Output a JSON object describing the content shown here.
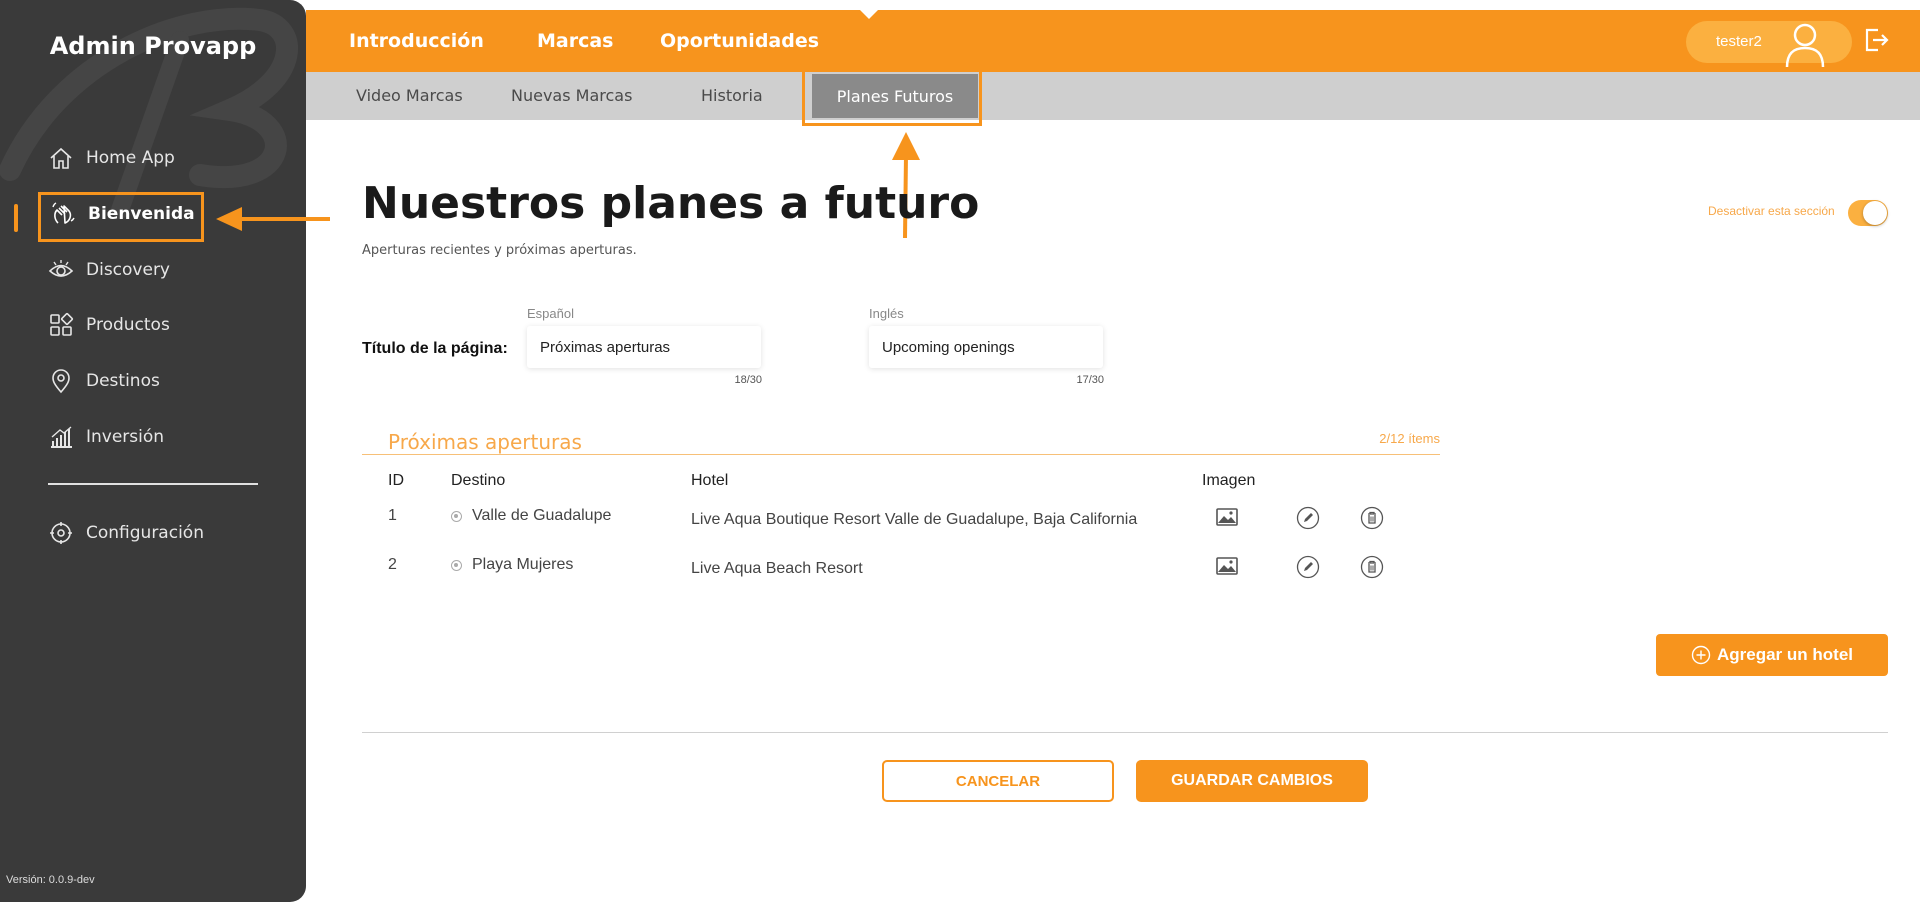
{
  "sidebar": {
    "title": "Admin Provapp",
    "items": [
      {
        "label": "Home App",
        "icon": "home-icon"
      },
      {
        "label": "Bienvenida",
        "icon": "waving-hand-icon",
        "active": true
      },
      {
        "label": "Discovery",
        "icon": "eye-icon"
      },
      {
        "label": "Productos",
        "icon": "grid-icon"
      },
      {
        "label": "Destinos",
        "icon": "location-pin-icon"
      },
      {
        "label": "Inversión",
        "icon": "bar-chart-icon"
      }
    ],
    "config_label": "Configuración",
    "version": "Versión: 0.0.9-dev"
  },
  "topbar": {
    "nav": [
      "Introducción",
      "Marcas",
      "Oportunidades"
    ],
    "active_nav": "Marcas",
    "username": "tester2"
  },
  "subbar": {
    "tabs": [
      "Video Marcas",
      "Nuevas Marcas",
      "Historia",
      "Planes Futuros"
    ],
    "active_tab": "Planes Futuros"
  },
  "page": {
    "title": "Nuestros planes a futuro",
    "subtitle": "Aperturas recientes y próximas aperturas.",
    "toggle_label": "Desactivar esta sección",
    "toggle_on": true
  },
  "title_field": {
    "label": "Título de la página:",
    "es_label": "Español",
    "es_value": "Próximas aperturas",
    "es_counter": "18/30",
    "en_label": "Inglés",
    "en_value": "Upcoming openings",
    "en_counter": "17/30"
  },
  "openings": {
    "title": "Próximas aperturas",
    "count": "2/12 ítems",
    "headers": [
      "ID",
      "Destino",
      "Hotel",
      "Imagen"
    ],
    "rows": [
      {
        "id": "1",
        "destino": "Valle de Guadalupe",
        "hotel": "Live Aqua Boutique Resort Valle de Guadalupe, Baja California"
      },
      {
        "id": "2",
        "destino": "Playa Mujeres",
        "hotel": "Live Aqua Beach Resort"
      }
    ],
    "add_label": "Agregar un hotel"
  },
  "actions": {
    "cancel": "CANCELAR",
    "save": "GUARDAR CAMBIOS"
  },
  "colors": {
    "accent": "#f7941d",
    "sidebar_bg": "#3a3a3a",
    "subbar_bg": "#cfcfcf"
  }
}
